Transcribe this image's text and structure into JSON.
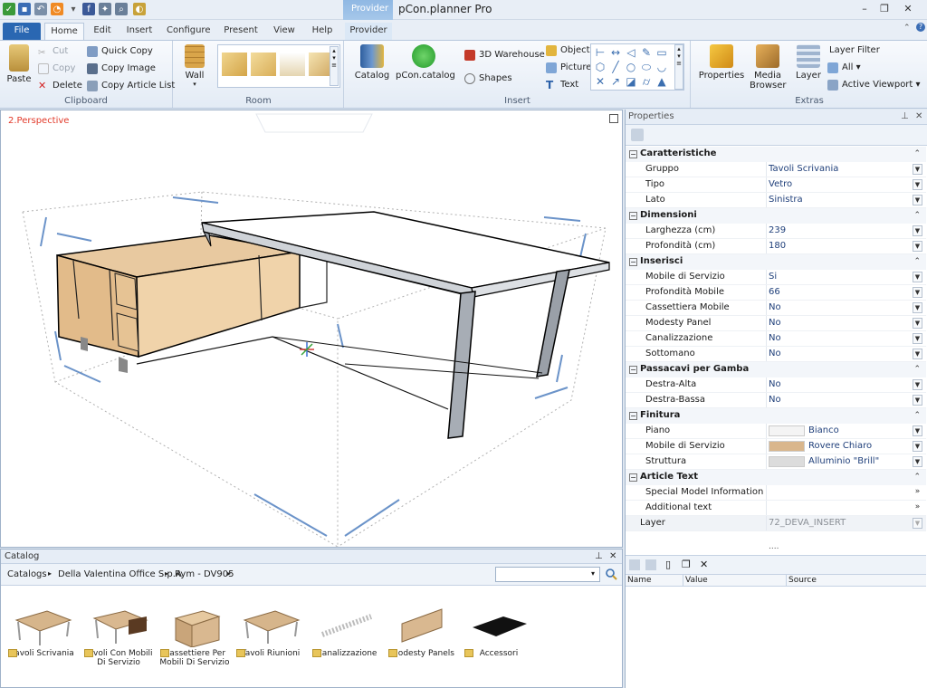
{
  "window": {
    "title": "pCon.planner Pro",
    "context_tab": "Provider"
  },
  "tabs": [
    "File",
    "Home",
    "Edit",
    "Insert",
    "Configure",
    "Present",
    "View",
    "Help",
    "Provider"
  ],
  "ribbon": {
    "clipboard": {
      "label": "Clipboard",
      "paste": "Paste",
      "cut": "Cut",
      "copy": "Copy",
      "delete": "Delete",
      "quick_copy": "Quick Copy",
      "copy_image": "Copy Image",
      "copy_article_list": "Copy Article List"
    },
    "room": {
      "label": "Room",
      "wall": "Wall"
    },
    "insert": {
      "label": "Insert",
      "catalog": "Catalog",
      "pcon_catalog": "pCon.catalog",
      "warehouse": "3D Warehouse",
      "shapes": "Shapes",
      "object": "Object",
      "picture": "Picture",
      "text": "Text"
    },
    "extras": {
      "label": "Extras",
      "properties": "Properties",
      "media_browser": "Media Browser",
      "layer": "Layer",
      "layer_filter": "Layer Filter",
      "all": "All",
      "active_viewport": "Active Viewport"
    }
  },
  "viewport": {
    "label": "2.Perspective"
  },
  "catalog": {
    "title": "Catalog",
    "breadcrumb": [
      "Catalogs",
      "Della Valentina Office S.p.A.",
      "Rym - DV905"
    ],
    "search_value": "",
    "items": [
      {
        "label": "Tavoli Scrivania"
      },
      {
        "label": "Tavoli Con Mobili Di Servizio"
      },
      {
        "label": "Cassettiere Per Mobili Di Servizio"
      },
      {
        "label": "Tavoli Riunioni"
      },
      {
        "label": "Canalizzazione"
      },
      {
        "label": "Modesty Panels"
      },
      {
        "label": "Accessori"
      }
    ]
  },
  "properties": {
    "title": "Properties",
    "sections": [
      {
        "title": "Caratteristiche",
        "rows": [
          {
            "key": "Gruppo",
            "value": "Tavoli Scrivania"
          },
          {
            "key": "Tipo",
            "value": "Vetro"
          },
          {
            "key": "Lato",
            "value": "Sinistra"
          }
        ]
      },
      {
        "title": "Dimensioni",
        "rows": [
          {
            "key": "Larghezza (cm)",
            "value": "239"
          },
          {
            "key": "Profondità (cm)",
            "value": "180"
          }
        ]
      },
      {
        "title": "Inserisci",
        "rows": [
          {
            "key": "Mobile di Servizio",
            "value": "Si"
          },
          {
            "key": "Profondità Mobile",
            "value": "66"
          },
          {
            "key": "Cassettiera Mobile",
            "value": "No"
          },
          {
            "key": "Modesty Panel",
            "value": "No"
          },
          {
            "key": "Canalizzazione",
            "value": "No"
          },
          {
            "key": "Sottomano",
            "value": "No"
          }
        ]
      },
      {
        "title": "Passacavi per Gamba",
        "rows": [
          {
            "key": "Destra-Alta",
            "value": "No"
          },
          {
            "key": "Destra-Bassa",
            "value": "No"
          }
        ]
      },
      {
        "title": "Finitura",
        "rows": [
          {
            "key": "Piano",
            "value": "Bianco",
            "swatch": "#f4f4f4"
          },
          {
            "key": "Mobile di Servizio",
            "value": "Rovere Chiaro",
            "swatch": "#d9b68c"
          },
          {
            "key": "Struttura",
            "value": "Alluminio \"Brill\"",
            "swatch": "#dcdcdc"
          }
        ]
      },
      {
        "title": "Article Text",
        "rows": [
          {
            "key": "Special Model Information",
            "value": ""
          },
          {
            "key": "Additional text",
            "value": ""
          }
        ]
      }
    ],
    "layer": {
      "key": "Layer",
      "value": "72_DEVA_INSERT"
    },
    "ellipsis": "....",
    "columns": [
      "Name",
      "Value",
      "Source"
    ]
  }
}
